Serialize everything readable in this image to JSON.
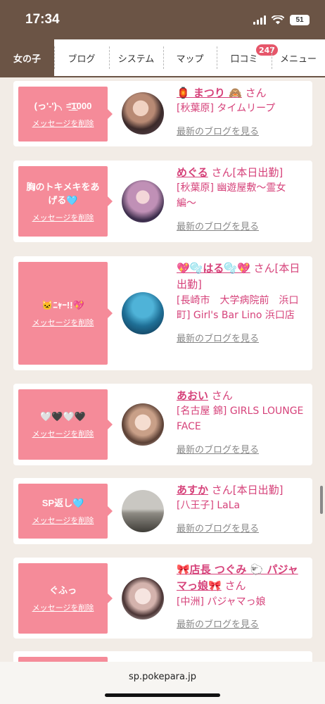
{
  "status_bar": {
    "time": "17:34",
    "battery": "51"
  },
  "nav": {
    "tabs": [
      "女の子",
      "ブログ",
      "システム",
      "マップ",
      "口コミ",
      "メニュー"
    ],
    "review_badge": "247"
  },
  "cards": [
    {
      "message": "(っ'-')╮=͟͟͞͞1000",
      "delete": "メッセージを削除",
      "name": "🏮 まつり 🙈",
      "san": " さん",
      "shop": "[秋葉原] タイムリープ",
      "more": "最新のブログを見る"
    },
    {
      "message": "胸のトキメキをあげる🩵",
      "delete": "メッセージを削除",
      "name": "めぐる",
      "san": " さん[本日出勤]",
      "shop": "[秋葉原] 幽遊屋敷〜霊女編〜",
      "more": "最新のブログを見る"
    },
    {
      "message": "🐱ﾆｬｰ!!💖",
      "delete": "メッセージを削除",
      "name": "💖🫧はる🫧💖",
      "san": " さん[本日出勤]",
      "shop": "[長崎市　大学病院前　浜口町] Girl's Bar Lino 浜口店",
      "more": "最新のブログを見る"
    },
    {
      "message": "🤍🖤🤍🖤",
      "delete": "メッセージを削除",
      "name": "あおい",
      "san": " さん",
      "shop": "[名古屋 錦] GIRLS LOUNGE FACE",
      "more": "最新のブログを見る"
    },
    {
      "message": "SP返し🩵",
      "delete": "メッセージを削除",
      "name": "あすか",
      "san": " さん[本日出勤]",
      "shop": "[八王子] LaLa",
      "more": "最新のブログを見る"
    },
    {
      "message": "ぐふっ",
      "delete": "メッセージを削除",
      "name": "🎀店長 つぐみ 🐑 パジャマっ娘🎀",
      "san": " さん",
      "shop": "[中洲] パジャマっ娘",
      "more": "最新のブログを見る"
    }
  ],
  "browser": {
    "url": "sp.pokepara.jp"
  },
  "colors": {
    "header_brown": "#6b5445",
    "bubble_pink": "#f58b99",
    "name_pink": "#d6427a",
    "badge_red": "#e6566a"
  }
}
